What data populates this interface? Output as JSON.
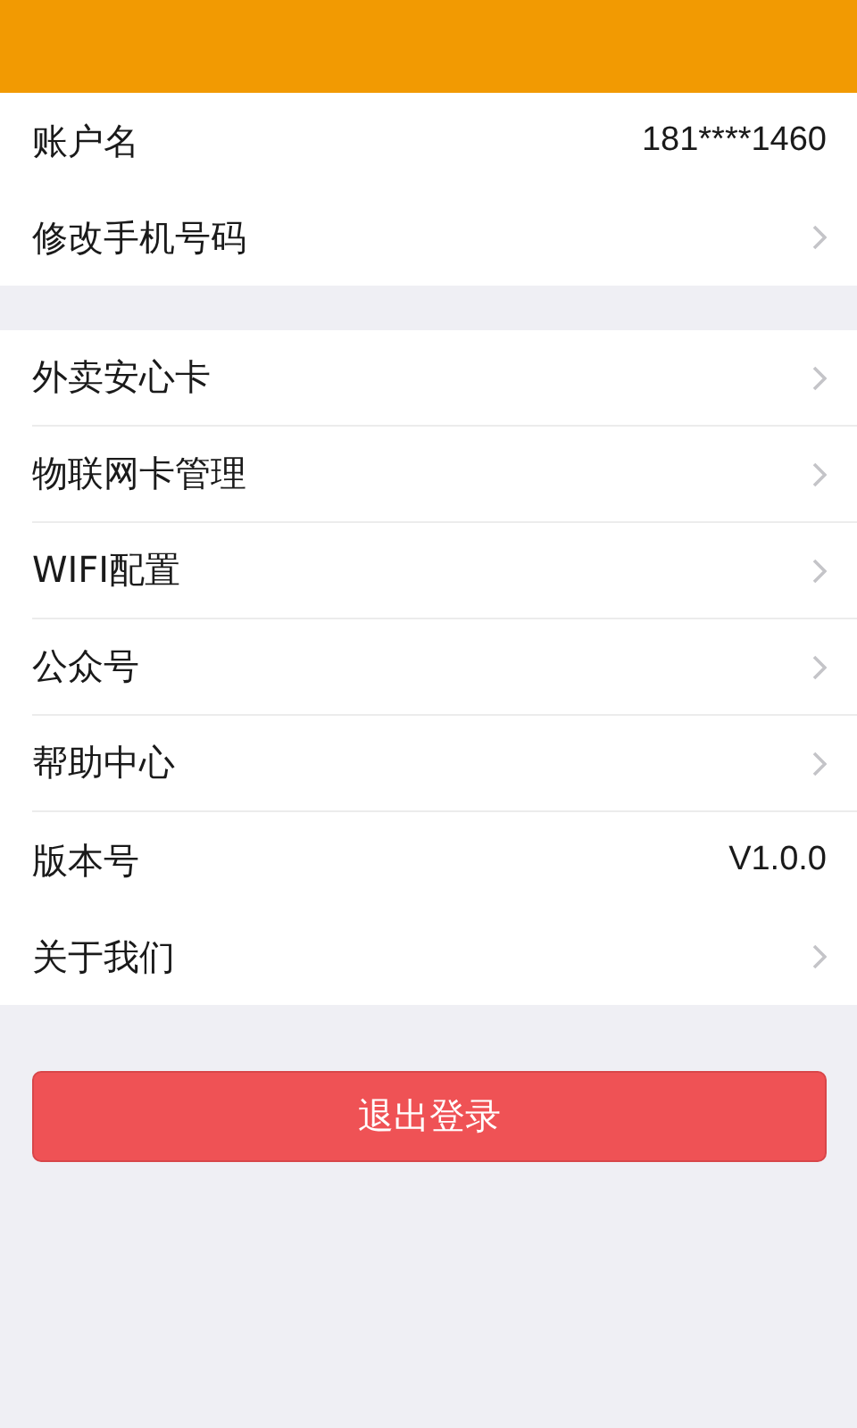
{
  "sections": [
    {
      "rows": [
        {
          "kind": "value",
          "label": "账户名",
          "value": "181****1460"
        },
        {
          "kind": "link",
          "label": "修改手机号码"
        }
      ]
    },
    {
      "rows": [
        {
          "kind": "link",
          "label": "外卖安心卡"
        },
        {
          "kind": "link",
          "label": "物联网卡管理"
        },
        {
          "kind": "link",
          "label": "WIFI配置"
        },
        {
          "kind": "link",
          "label": "公众号"
        },
        {
          "kind": "link",
          "label": "帮助中心"
        },
        {
          "kind": "value",
          "label": "版本号",
          "value": "V1.0.0"
        },
        {
          "kind": "link",
          "label": "关于我们"
        }
      ]
    }
  ],
  "logout_button": "退出登录"
}
